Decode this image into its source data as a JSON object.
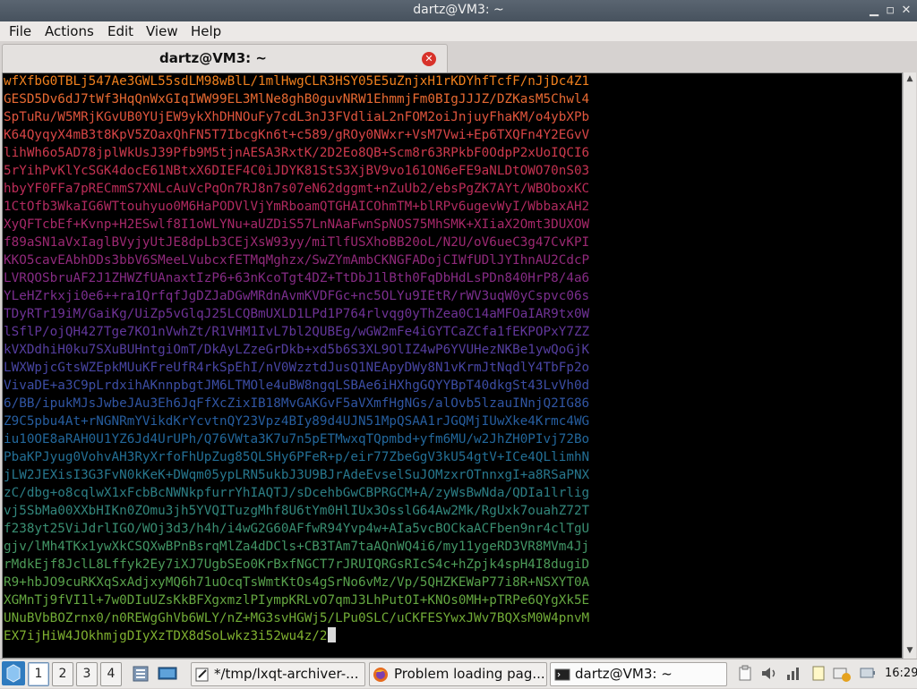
{
  "window": {
    "title": "dartz@VM3: ~",
    "controls": [
      "minimize",
      "maximize",
      "close"
    ]
  },
  "menu": [
    "File",
    "Actions",
    "Edit",
    "View",
    "Help"
  ],
  "tab": {
    "label": "dartz@VM3: ~",
    "close_icon": "close-icon"
  },
  "terminal": {
    "lines": [
      "wfXfbG0TBLj547Ae3GWL55sdLM98wBlL/1mlHwgCLR3HSY05E5uZnjxH1rKDYhfTcfF/nJjDc4Z1",
      "GESD5Dv6dJ7tWf3HqQnWxGIqIWW99EL3MlNe8ghB0guvNRW1EhmmjFm0BIgJJJZ/DZKasM5Chwl4",
      "SpTuRu/W5MRjKGvUB0YUjEW9ykXhDHNOuFy7cdL3nJ3FVdliaL2nFOM2oiJnjuyFhaKM/o4ybXPb",
      "K64QyqyX4mB3t8KpV5ZOaxQhFN5T7IbcgKn6t+c589/gROy0NWxr+VsM7Vwi+Ep6TXQFn4Y2EGvV",
      "lihWh6o5AD78jplWkUsJ39Pfb9M5tjnAESA3RxtK/2D2Eo8QB+Scm8r63RPkbF0OdpP2xUoIQCI6",
      "5rYihPvKlYcSGK4docE61NBtxX6DIEF4C0iJDYK81StS3XjBV9vo161ON6eFE9aNLDtOWO70nS03",
      "hbyYF0FFa7pRECmmS7XNLcAuVcPqOn7RJ8n7s07eN62dggmt+nZuUb2/ebsPgZK7AYt/WBOboxKC",
      "1CtOfb3WkaIG6WTtouhyuo0M6HaPODVlVjYmRboamQTGHAICOhmTM+blRPv6ugevWyI/WbbaxAH2",
      "XyQFTcbEf+Kvnp+H2ESwlf8I1oWLYNu+aUZDiS57LnNAaFwnSpNOS75MhSMK+XIiaX2Omt3DUXOW",
      "f89aSN1aVxIaglBVyjyUtJE8dpLb3CEjXsW93yy/miTlfUSXhoBB20oL/N2U/oV6ueC3g47CvKPI",
      "KKO5cavEAbhDDs3bbV6SMeeLVubcxfETMqMghzx/SwZYmAmbCKNGFADojCIWfUDlJYIhnAU2CdcP",
      "LVRQOSbruAF2J1ZHWZfUAnaxtIzP6+63nKcoTgt4DZ+TtDbJ1lBth0FqDbHdLsPDn840HrP8/4a6",
      "YLeHZrkxji0e6++ra1QrfqfJgDZJaDGwMRdnAvmKVDFGc+nc5OLYu9IEtR/rWV3uqW0yCspvc06s",
      "TDyRTr19iM/GaiKg/UiZp5vGlqJ25LCQBmUXLD1LPd1P764rlvqg0yThZea0C14aMFOaIAR9tx0W",
      "lSflP/ojQH427Tge7KO1nVwhZt/R1VHM1IvL7bl2QUBEg/wGW2mFe4iGYTCaZCfa1fEKPOPxY7ZZ",
      "kVXDdhiH0ku7SXuBUHntgiOmT/DkAyLZzeGrDkb+xd5b6S3XL9OlIZ4wP6YVUHezNKBe1ywQoGjK",
      "LWXWpjcGtsWZEpkMUuKFreUfR4rkSpEhI/nV0WzztdJusQ1NEApyDWy8N1vKrmJtNqdlY4TbFp2o",
      "VivaDE+a3C9pLrdxihAKnnpbgtJM6LTMOle4uBW8ngqLSBAe6iHXhgGQYYBpT40dkgSt43LvVh0d",
      "6/BB/ipukMJsJwbeJAu3Eh6JqFfXcZixIB18MvGAKGvF5aVXmfHgNGs/alOvb5lzauINnjQ2IG86",
      "Z9C5pbu4At+rNGNRmYVikdKrYcvtnQY23Vpz4BIy89d4UJN51MpQSAA1rJGQMjIUwXke4Krmc4WG",
      "iu10OE8aRAH0U1YZ6Jd4UrUPh/Q76VWta3K7u7n5pETMwxqTQpmbd+yfm6MU/w2JhZH0PIvj72Bo",
      "PbaKPJyug0VohvAH3RyXrfoFhUpZug85QLSHy6PFeR+p/eir77ZbeGgV3kU54gtV+ICe4QLlimhN",
      "jLW2JEXisI3G3FvN0kKeK+DWqm05ypLRN5ukbJ3U9BJrAdeEvselSuJOMzxrOTnnxgI+a8RSaPNX",
      "zC/dbg+o8cqlwX1xFcbBcNWNkpfurrYhIAQTJ/sDcehbGwCBPRGCM+A/zyWsBwNda/QDIa1lrlig",
      "vj5SbMa00XXbHIKn0ZOmu3jh5YVQITuzgMhf8U6tYm0HlIUx3OsslG64Aw2Mk/RgUxk7ouahZ72T",
      "f238yt25ViJdrlIGO/WOj3d3/h4h/i4wG2G60AFfwR94Yvp4w+AIa5vcBOCkaACFben9nr4clTgU",
      "gjv/lMh4TKx1ywXkCSQXwBPnBsrqMlZa4dDCls+CB3TAm7taAQnWQ4i6/my11ygeRD3VR8MVm4Jj",
      "rMdkEjf8JclL8Lffyk2Ey7iXJ7UgbSEo0KrBxfNGCT7rJRUIQRGsRIcS4c+hZpjk4spH4I8dugiD",
      "R9+hbJO9cuRKXqSxAdjxyMQ6h71uOcqTsWmtKtOs4gSrNo6vMz/Vp/5QHZKEWaP77i8R+NSXYT0A",
      "XGMnTj9fVI1l+7w0DIuUZsKkBFXgxmzlPIympKRLvO7qmJ3LhPutOI+KNOs0MH+pTRPe6QYgXk5E",
      "UNuBVbBOZrnx0/n0REWgGhVb6WLY/nZ+MG3svHGWj5/LPu0SLC/uCKFESYwxJWv7BQXsM0W4pnvM",
      "EX7ijHiW4JOkhmjgDIyXzTDX8dSoLwkz3i52wu4z/2"
    ],
    "colors": [
      "#f0801e",
      "#e86a32",
      "#e0553d",
      "#d74546",
      "#ce3a4d",
      "#c53251",
      "#bc2c58",
      "#b12a60",
      "#a72869",
      "#9c2872",
      "#91297c",
      "#862b85",
      "#7b2e8e",
      "#6f3296",
      "#62379c",
      "#553ea0",
      "#4845a3",
      "#3c4da4",
      "#3055a3",
      "#265ea0",
      "#22679b",
      "#236f95",
      "#27778e",
      "#2c7f86",
      "#32877d",
      "#398e72",
      "#429566",
      "#4c9b58",
      "#58a14b",
      "#65a740",
      "#72ac37",
      "#7fb02f"
    ]
  },
  "taskbar": {
    "desktops": [
      "1",
      "2",
      "3",
      "4"
    ],
    "tasks": [
      {
        "label": "*/tmp/lxqt-archiver-...",
        "icon": "text-editor-icon"
      },
      {
        "label": "Problem loading pag...",
        "icon": "firefox-icon"
      },
      {
        "label": "dartz@VM3: ~",
        "icon": "terminal-icon"
      }
    ],
    "clock": "16:29"
  }
}
